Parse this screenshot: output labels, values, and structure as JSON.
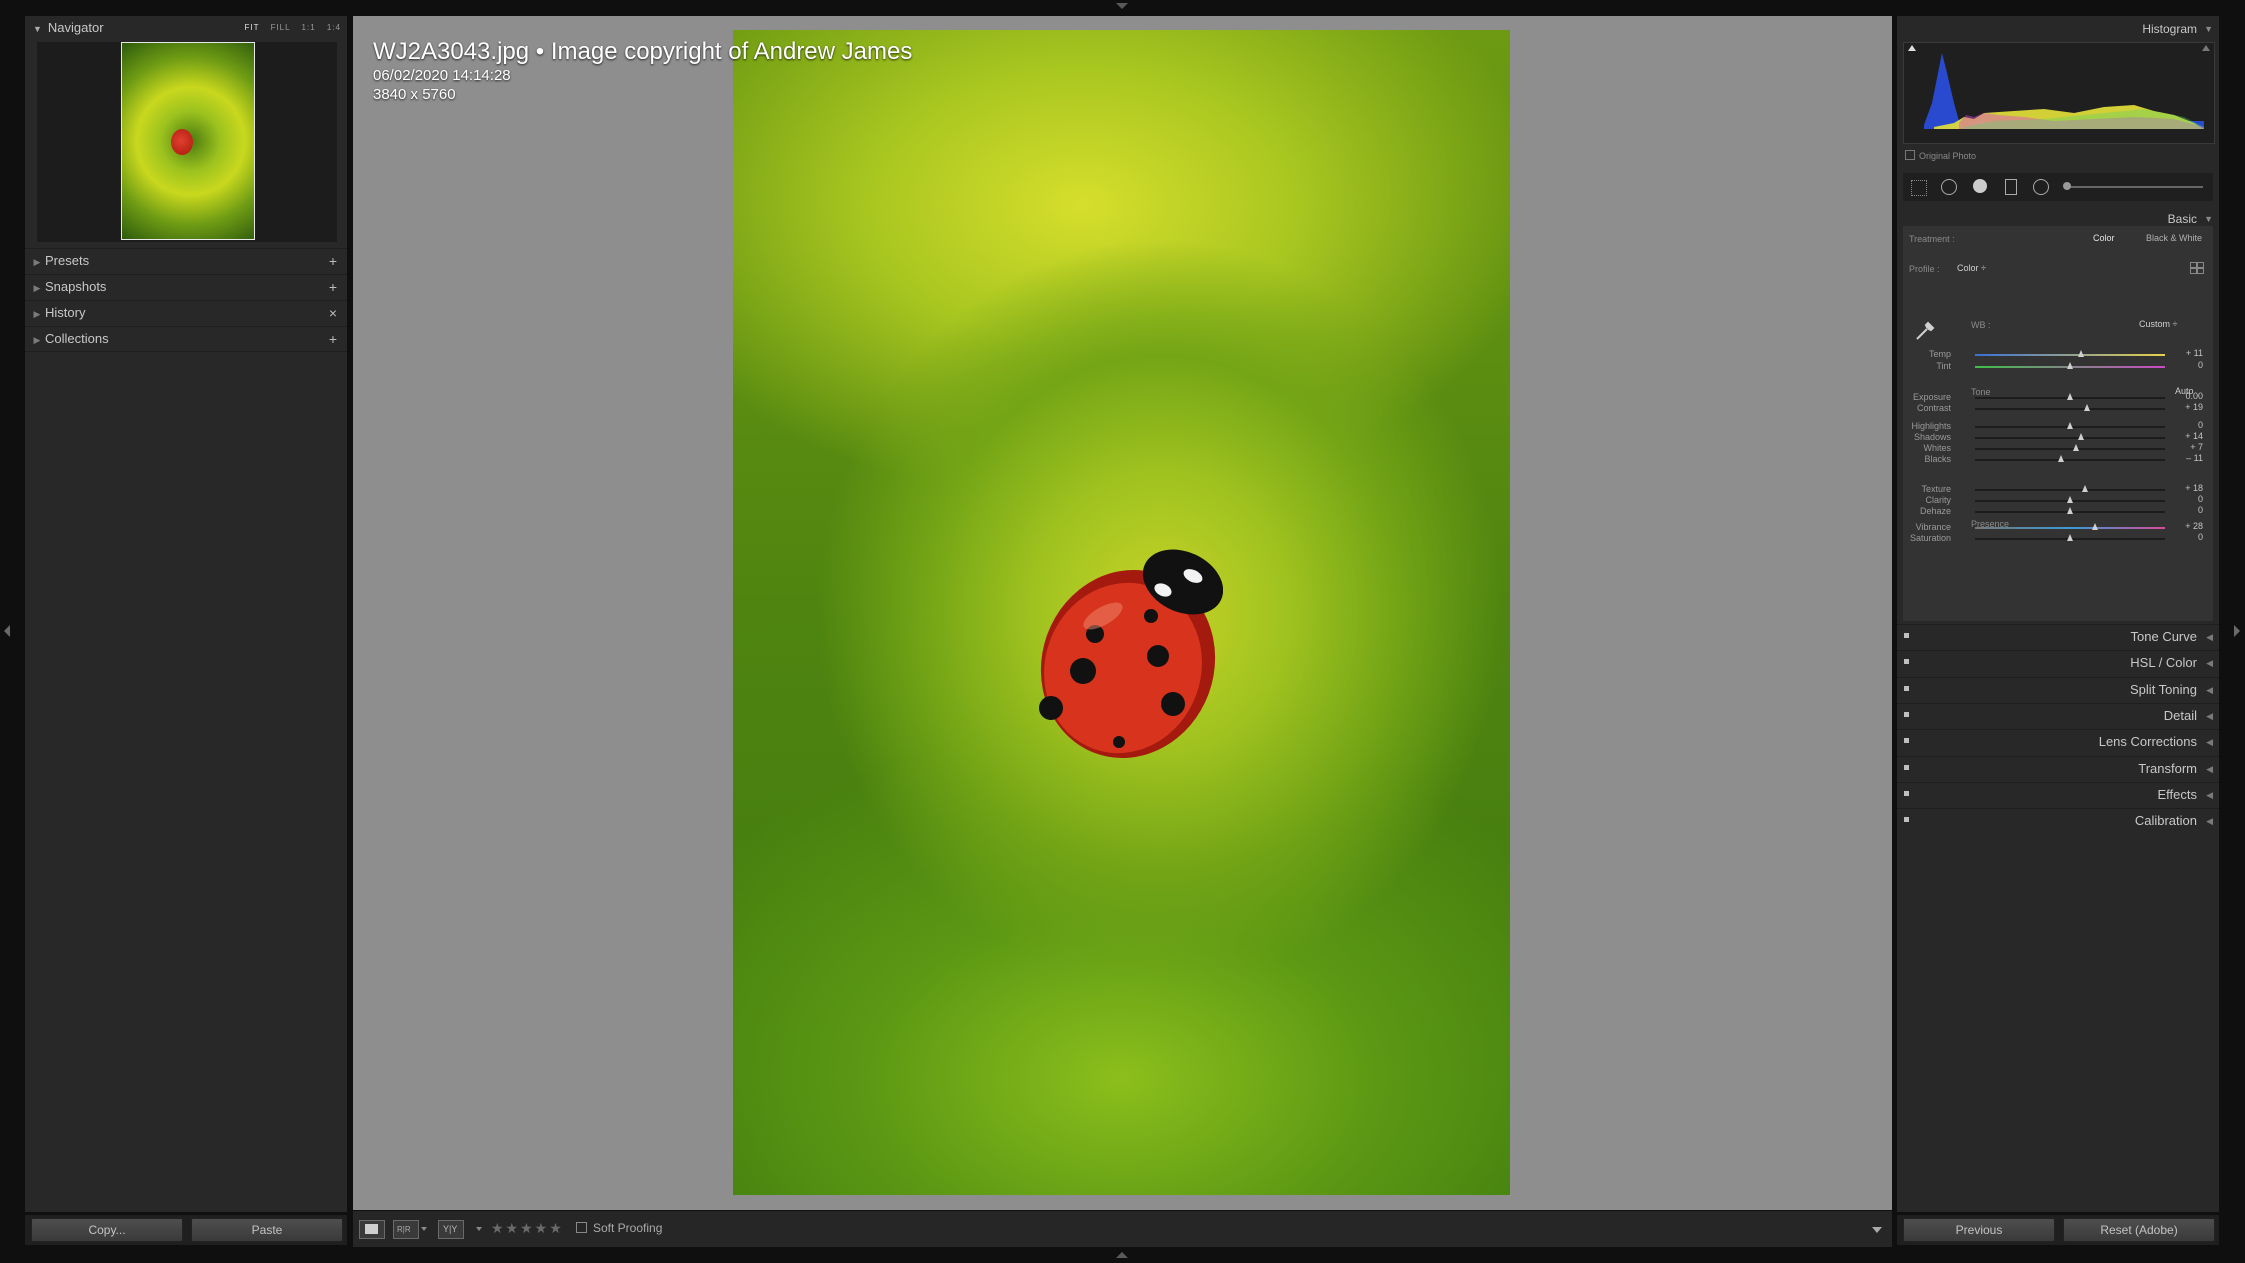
{
  "left_panel": {
    "navigator": {
      "title": "Navigator",
      "modes": [
        "FIT",
        "FILL",
        "1:1",
        "1:4"
      ]
    },
    "sections": [
      {
        "label": "Presets",
        "action": "+"
      },
      {
        "label": "Snapshots",
        "action": "+"
      },
      {
        "label": "History",
        "action": "×"
      },
      {
        "label": "Collections",
        "action": "+"
      }
    ],
    "copy_label": "Copy...",
    "paste_label": "Paste"
  },
  "photo": {
    "title": "WJ2A3043.jpg  •  Image copyright of Andrew James",
    "date": "06/02/2020 14:14:28",
    "dimensions": "3840 x 5760"
  },
  "toolbar": {
    "loupe_icon": "loupe-view-icon",
    "compare_icon": "before-after-icon",
    "survey_icon": "yy-view-icon",
    "stars": "★★★★★",
    "rating": 0,
    "soft_proofing_label": "Soft Proofing"
  },
  "right_panel": {
    "histogram_title": "Histogram",
    "original_photo_label": "Original Photo",
    "basic_title": "Basic",
    "treatment_label": "Treatment :",
    "treatment_color": "Color",
    "treatment_bw": "Black & White",
    "profile_label": "Profile :",
    "profile_value": "Color ÷",
    "wb_label": "WB :",
    "wb_value": "Custom ÷",
    "tone_label": "Tone",
    "auto_label": "Auto",
    "presence_label": "Presence",
    "sliders": {
      "temp": {
        "label": "Temp",
        "value": "+ 11",
        "level": 0.56
      },
      "tint": {
        "label": "Tint",
        "value": "0",
        "level": 0.5
      },
      "exposure": {
        "label": "Exposure",
        "value": "0.00",
        "level": 0.5
      },
      "contrast": {
        "label": "Contrast",
        "value": "+ 19",
        "level": 0.59
      },
      "highlights": {
        "label": "Highlights",
        "value": "0",
        "level": 0.5
      },
      "shadows": {
        "label": "Shadows",
        "value": "+ 14",
        "level": 0.56
      },
      "whites": {
        "label": "Whites",
        "value": "+ 7",
        "level": 0.53
      },
      "blacks": {
        "label": "Blacks",
        "value": "– 11",
        "level": 0.45
      },
      "texture": {
        "label": "Texture",
        "value": "+ 18",
        "level": 0.58
      },
      "clarity": {
        "label": "Clarity",
        "value": "0",
        "level": 0.5
      },
      "dehaze": {
        "label": "Dehaze",
        "value": "0",
        "level": 0.5
      },
      "vibrance": {
        "label": "Vibrance",
        "value": "+ 28",
        "level": 0.63
      },
      "saturation": {
        "label": "Saturation",
        "value": "0",
        "level": 0.5
      }
    },
    "collapsed_panels": [
      "Tone Curve",
      "HSL / Color",
      "Split Toning",
      "Detail",
      "Lens Corrections",
      "Transform",
      "Effects",
      "Calibration"
    ],
    "previous_label": "Previous",
    "reset_label": "Reset (Adobe)"
  }
}
